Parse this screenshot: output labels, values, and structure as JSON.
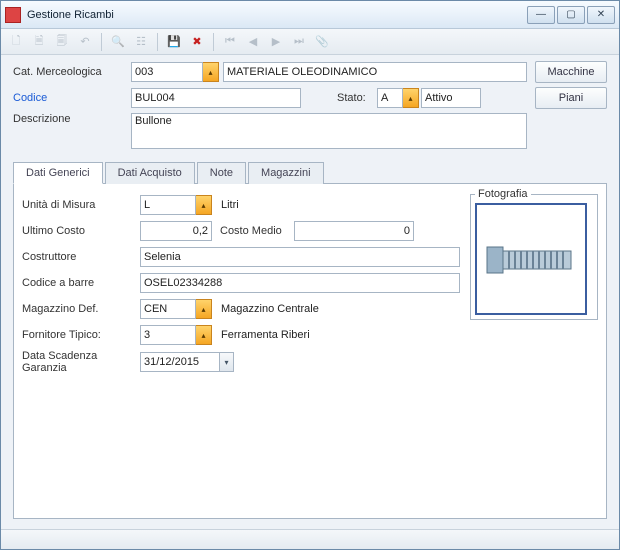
{
  "window": {
    "title": "Gestione Ricambi"
  },
  "buttons": {
    "macchine": "Macchine",
    "piani": "Piani"
  },
  "labels": {
    "cat": "Cat. Merceologica",
    "codice": "Codice",
    "stato": "Stato:",
    "descrizione": "Descrizione",
    "um": "Unità di Misura",
    "ultimo_costo": "Ultimo Costo",
    "costo_medio": "Costo Medio",
    "costruttore": "Costruttore",
    "barcode": "Codice a barre",
    "magazzino": "Magazzino Def.",
    "fornitore": "Fornitore Tipico:",
    "scadenza": "Data Scadenza Garanzia",
    "fotografia": "Fotografia"
  },
  "tabs": {
    "generici": "Dati Generici",
    "acquisto": "Dati Acquisto",
    "note": "Note",
    "magazzini": "Magazzini"
  },
  "fields": {
    "cat_code": "003",
    "cat_desc": "MATERIALE OLEODINAMICO",
    "codice": "BUL004",
    "stato_code": "A",
    "stato_desc": "Attivo",
    "descrizione": "Bullone",
    "um_code": "L",
    "um_desc": "Litri",
    "ultimo_costo": "0,2",
    "costo_medio": "0",
    "costruttore": "Selenia",
    "barcode": "OSEL02334288",
    "mag_code": "CEN",
    "mag_desc": "Magazzino Centrale",
    "forn_code": "3",
    "forn_desc": "Ferramenta Riberi",
    "scadenza": "31/12/2015"
  }
}
